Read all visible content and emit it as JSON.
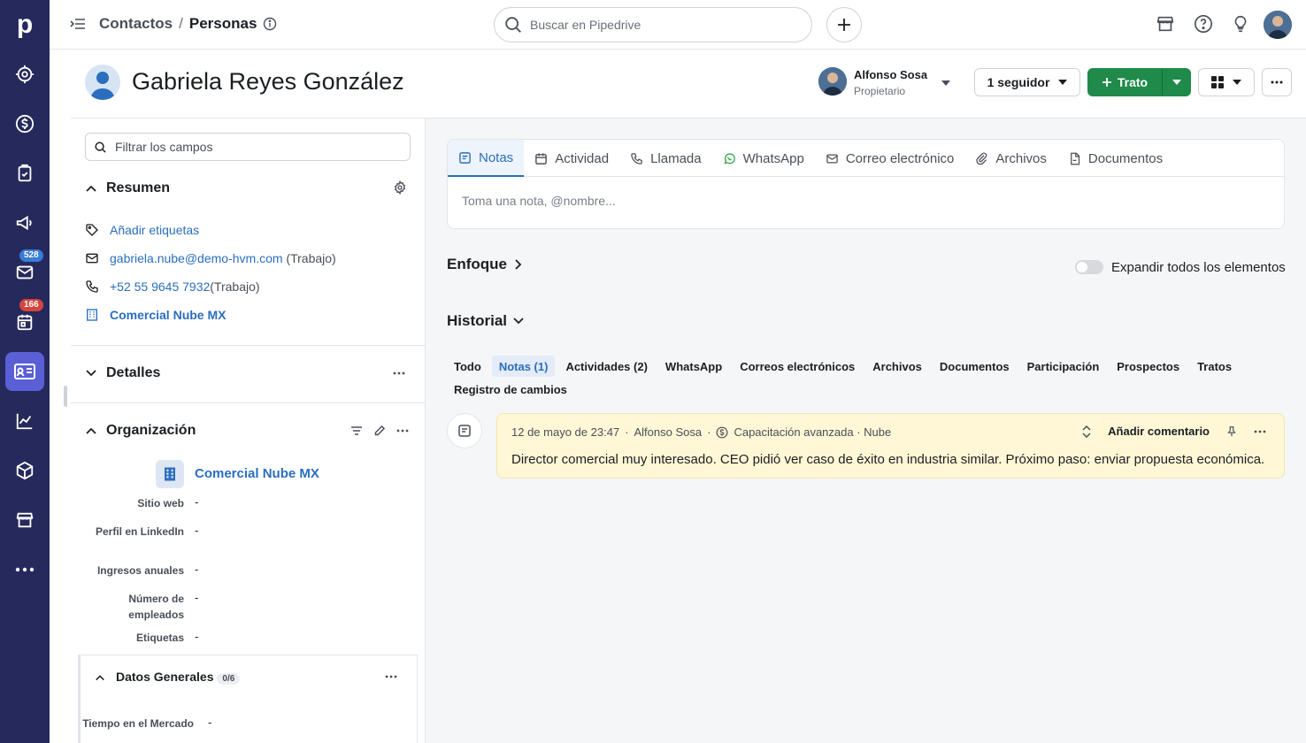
{
  "nav": {
    "logo": "p",
    "badges": {
      "mail": "528",
      "activities": "166"
    }
  },
  "topbar": {
    "breadcrumb_parent": "Contactos",
    "breadcrumb_sep": "/",
    "breadcrumb_current": "Personas",
    "search_placeholder": "Buscar en Pipedrive"
  },
  "header": {
    "person_name": "Gabriela Reyes González",
    "owner_name": "Alfonso Sosa",
    "owner_role": "Propietario",
    "follow_label": "1 seguidor",
    "deal_label": "Trato"
  },
  "sidebar": {
    "filter_placeholder": "Filtrar los campos",
    "summary": {
      "title": "Resumen",
      "add_tags": "Añadir etiquetas",
      "email": "gabriela.nube@demo-hvm.com",
      "email_type": "(Trabajo)",
      "phone": "+52 55 9645 7932",
      "phone_type": "(Trabajo)",
      "org": "Comercial Nube MX"
    },
    "details_title": "Detalles",
    "organization": {
      "title": "Organización",
      "name": "Comercial Nube MX",
      "fields": [
        {
          "label": "Sitio web",
          "value": "-"
        },
        {
          "label": "Perfil en LinkedIn",
          "value": "-"
        },
        {
          "label": "Ingresos anuales",
          "value": "-"
        },
        {
          "label": "Número de empleados",
          "value": "-"
        },
        {
          "label": "Etiquetas",
          "value": "-"
        }
      ]
    },
    "general": {
      "title": "Datos Generales",
      "count": "0/6",
      "fields": [
        {
          "label": "Tiempo en el Mercado",
          "value": "-"
        }
      ]
    }
  },
  "main": {
    "tabs": [
      {
        "label": "Notas",
        "icon": "note-icon"
      },
      {
        "label": "Actividad",
        "icon": "calendar-icon"
      },
      {
        "label": "Llamada",
        "icon": "phone-icon"
      },
      {
        "label": "WhatsApp",
        "icon": "whatsapp-icon"
      },
      {
        "label": "Correo electrónico",
        "icon": "mail-icon"
      },
      {
        "label": "Archivos",
        "icon": "paperclip-icon"
      },
      {
        "label": "Documentos",
        "icon": "document-icon"
      }
    ],
    "note_placeholder": "Toma una nota, @nombre...",
    "focus_title": "Enfoque",
    "expand_label": "Expandir todos los elementos",
    "history_title": "Historial",
    "history_tabs": [
      "Todo",
      "Notas (1)",
      "Actividades (2)",
      "WhatsApp",
      "Correos electrónicos",
      "Archivos",
      "Documentos",
      "Participación",
      "Prospectos",
      "Tratos",
      "Registro de cambios"
    ],
    "note": {
      "date": "12 de mayo de 23:47",
      "author": "Alfonso Sosa",
      "deal": "Capacitación avanzada · Nube",
      "add_comment": "Añadir comentario",
      "text": "Director comercial muy interesado. CEO pidió ver caso de éxito en industria similar. Próximo paso: enviar propuesta económica."
    }
  },
  "colors": {
    "nav_bg": "#26295c",
    "nav_active": "#5a5fd6",
    "link": "#2a6ebd",
    "deal_green": "#1f8a4a",
    "note_bg": "#fff7d6"
  }
}
